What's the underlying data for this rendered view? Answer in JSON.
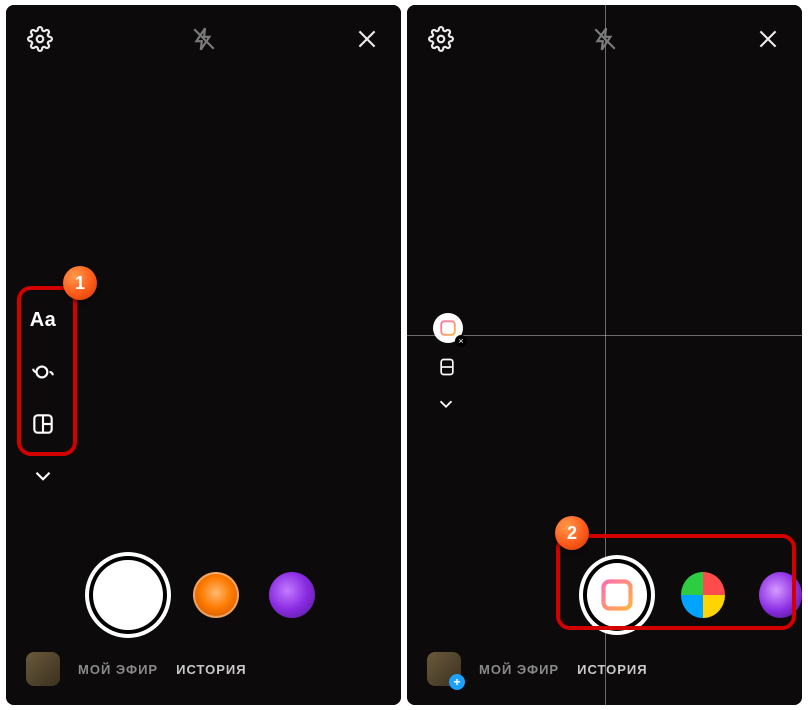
{
  "callouts": {
    "one": "1",
    "two": "2"
  },
  "left": {
    "rail": {
      "text_tool": "Aa"
    },
    "modes": {
      "live": "МОЙ ЭФИР",
      "story": "ИСТОРИЯ"
    }
  },
  "right": {
    "modes": {
      "live": "МОЙ ЭФИР",
      "story": "ИСТОРИЯ"
    }
  },
  "icons": {
    "settings": "settings",
    "flash": "flash-off",
    "close": "close",
    "boomerang": "boomerang",
    "layout": "layout",
    "chevron": "chevron-down"
  }
}
